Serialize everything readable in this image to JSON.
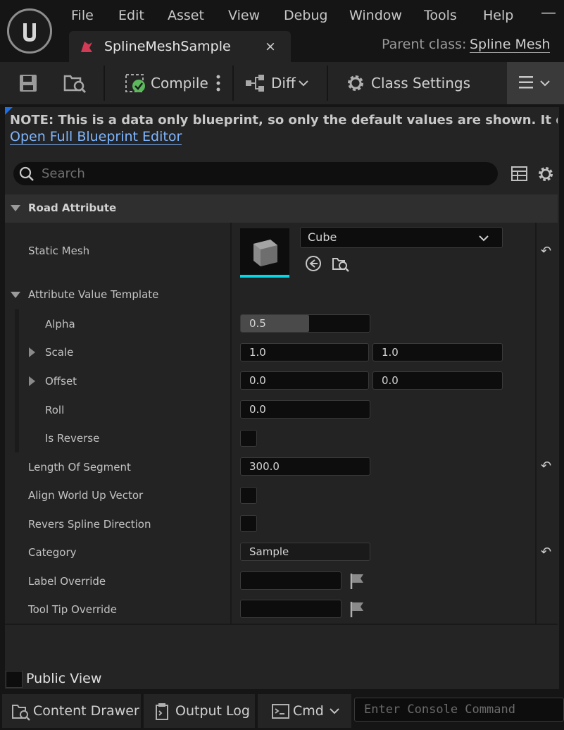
{
  "menu": [
    "File",
    "Edit",
    "Asset",
    "View",
    "Debug",
    "Window",
    "Tools",
    "Help"
  ],
  "tab": {
    "title": "SplineMeshSample",
    "close": "×"
  },
  "parent_class": {
    "label": "Parent class:",
    "value": "Spline Mesh"
  },
  "window_controls": {
    "minimize": "—"
  },
  "toolbar": {
    "compile": "Compile",
    "diff": "Diff",
    "class_settings": "Class Settings"
  },
  "note": {
    "text": "NOTE: This is a data only blueprint, so only the default values are shown.  It does not hav",
    "link": "Open Full Blueprint Editor"
  },
  "search": {
    "placeholder": "Search"
  },
  "category": {
    "label": "Road Attribute"
  },
  "static_mesh": {
    "label": "Static Mesh",
    "value": "Cube"
  },
  "attribute_template": {
    "label": "Attribute Value Template"
  },
  "alpha": {
    "label": "Alpha",
    "value": "0.5",
    "fill": 0.5
  },
  "scale": {
    "label": "Scale",
    "x": "1.0",
    "y": "1.0"
  },
  "offset": {
    "label": "Offset",
    "x": "0.0",
    "y": "0.0"
  },
  "roll": {
    "label": "Roll",
    "value": "0.0"
  },
  "is_reverse": {
    "label": "Is Reverse",
    "checked": false
  },
  "length_of_segment": {
    "label": "Length Of Segment",
    "value": "300.0"
  },
  "align_world_up": {
    "label": "Align World Up Vector",
    "checked": false
  },
  "revers_spline": {
    "label": "Revers Spline Direction",
    "checked": false
  },
  "category_field": {
    "label": "Category",
    "value": "Sample"
  },
  "label_override": {
    "label": "Label Override",
    "value": ""
  },
  "tooltip_override": {
    "label": "Tool Tip Override",
    "value": ""
  },
  "public_view": {
    "label": "Public View",
    "checked": false
  },
  "statusbar": {
    "content_drawer": "Content Drawer",
    "output_log": "Output Log",
    "cmd": "Cmd",
    "console_placeholder": "Enter Console Command"
  },
  "colors": {
    "background": "#151515",
    "panel": "#242424",
    "link": "#7fb6ff",
    "thumbnail_accent": "#00d8e8"
  }
}
